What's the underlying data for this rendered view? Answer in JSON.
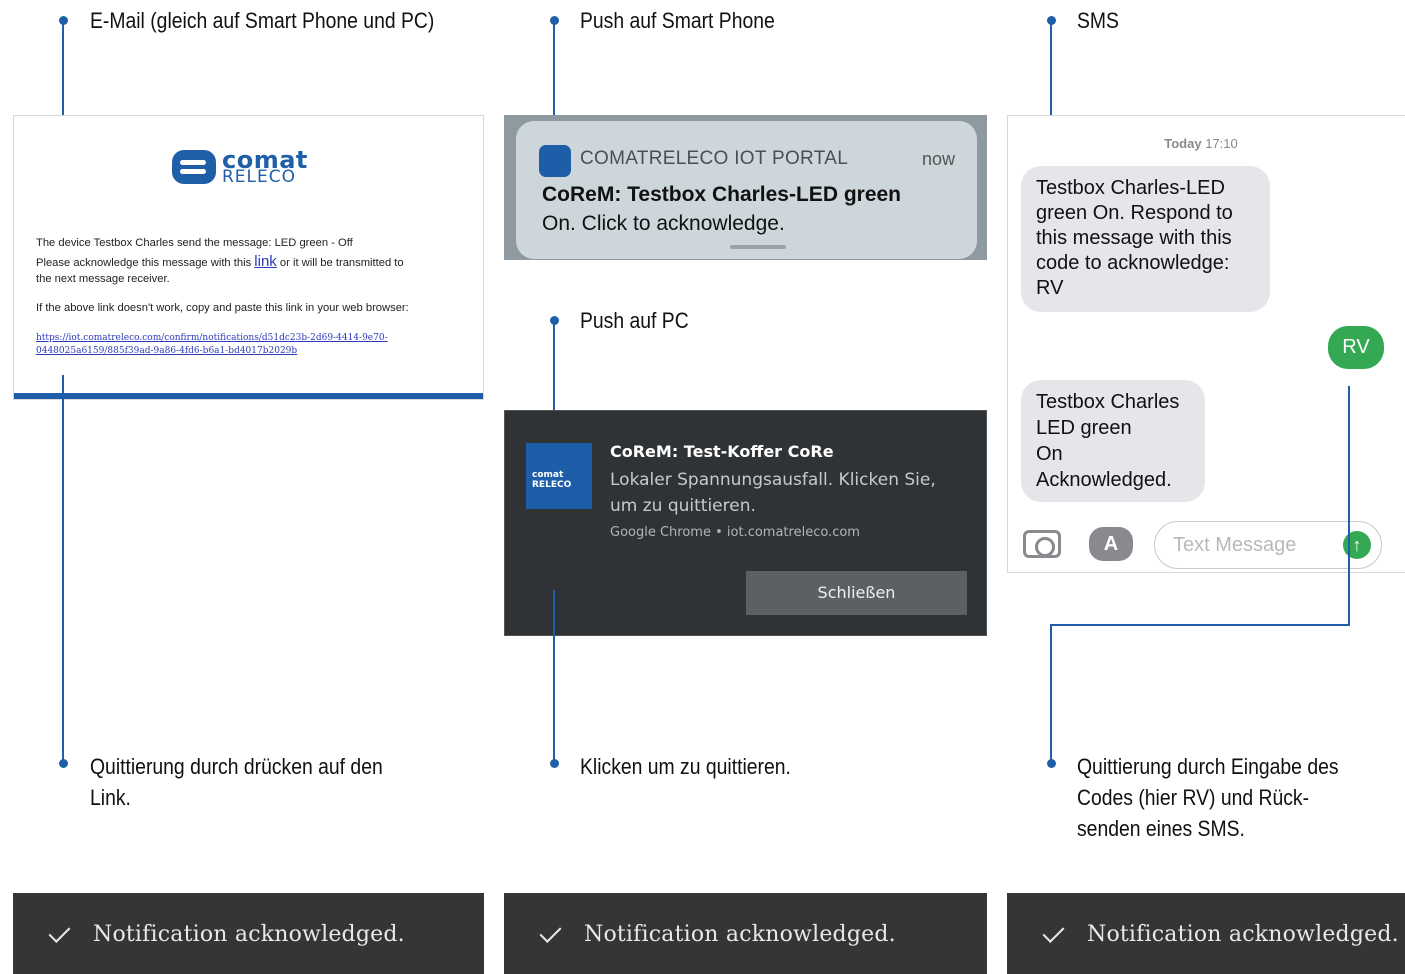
{
  "labels": {
    "email_heading": "E-Mail (gleich auf Smart Phone und PC)",
    "push_phone_heading": "Push auf Smart Phone",
    "sms_heading": "SMS",
    "push_pc_heading": "Push auf PC",
    "email_ack": [
      "Quittierung durch drücken auf den",
      "Link."
    ],
    "push_ack": "Klicken um zu quittieren.",
    "sms_ack": [
      "Quittierung durch Eingabe des",
      "Codes (hier RV) und Rück-",
      "senden eines SMS."
    ]
  },
  "email": {
    "logo_word1": "comat",
    "logo_word2": "RELECO",
    "line1": "The device Testbox Charles send the message: LED green - Off",
    "line2_before": "Please acknowledge this message with this ",
    "line2_link": "link",
    "line2_after": " or it will be transmitted to",
    "line3": "the next message receiver.",
    "line4": "If the above link doesn't work, copy and paste this link in your web browser:",
    "url_line1": "https://iot.comatreleco.com/confirm/notifications/d51dc23b-2d69-4414-9e70-",
    "url_line2": "0448025a6159/885f39ad-9a86-4fd6-b6a1-bd4017b2029b"
  },
  "push_phone": {
    "app_name": "COMATRELECO IOT PORTAL",
    "time": "now",
    "title": "CoReM: Testbox Charles-LED green",
    "body": "On. Click to acknowledge."
  },
  "push_pc": {
    "icon_text": "comat RELECO",
    "title": "CoReM: Test-Koffer CoRe",
    "body": "Lokaler Spannungsausfall. Klicken Sie, um zu quittieren.",
    "source": "Google Chrome • iot.comatreleco.com",
    "close_button": "Schließen"
  },
  "sms": {
    "timestamp_label": "Today",
    "timestamp_time": "17:10",
    "incoming1": "Testbox Charles-LED green On. Respond to this message with this code to acknowledge: RV",
    "outgoing1": "RV",
    "incoming2": [
      "Testbox Charles",
      "LED green",
      "On",
      "Acknowledged."
    ],
    "input_placeholder": "Text Message",
    "appstore_glyph": "A",
    "send_glyph": "↑"
  },
  "toasts": [
    "Notification acknowledged.",
    "Notification acknowledged.",
    "Notification acknowledged."
  ],
  "colors": {
    "accent_blue": "#1f5fa8",
    "sms_green": "#34a853",
    "toast_bg": "#353535",
    "pc_bg": "#2f3336"
  }
}
